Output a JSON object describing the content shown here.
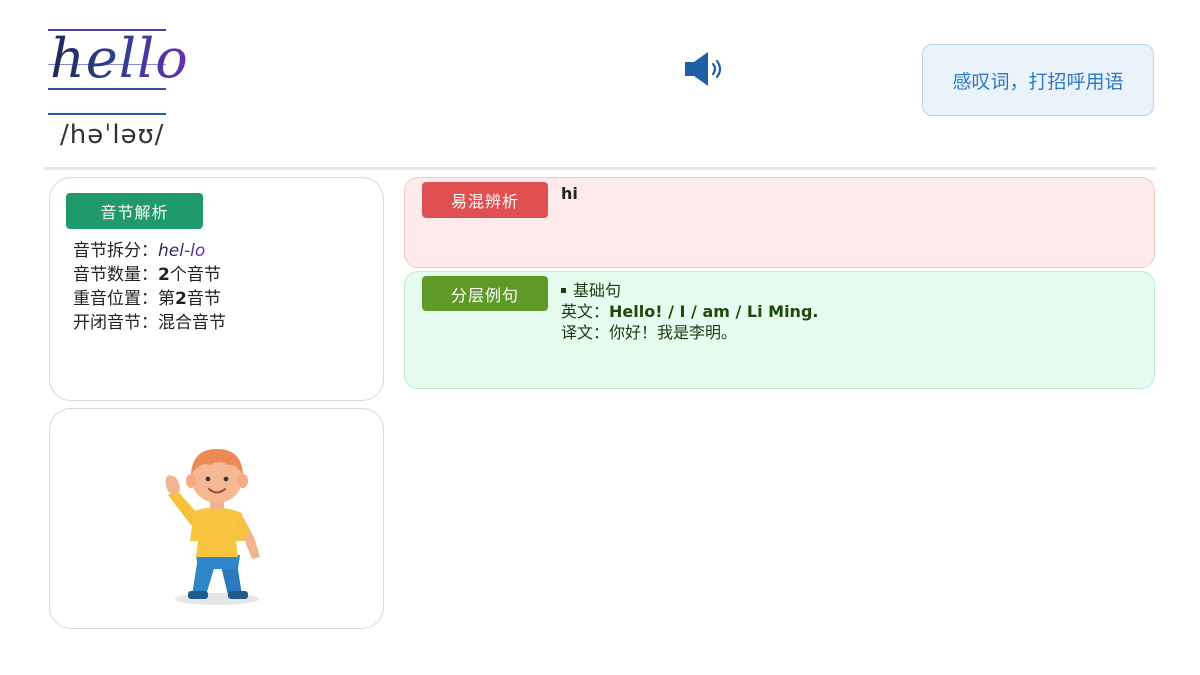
{
  "header": {
    "word": "hello",
    "phonetic": "/həˈləʊ/",
    "meaning": "感叹词，打招呼用语",
    "speaker_icon": "speaker-icon"
  },
  "syllable": {
    "tag": "音节解析",
    "split_label": "音节拆分：",
    "split_value": "hel-lo",
    "count_label": "音节数量：",
    "count_num": "2",
    "count_unit": "个音节",
    "stress_label": "重音位置：",
    "stress_pre": "第",
    "stress_num": "2",
    "stress_unit": "音节",
    "type_label": "开闭音节：",
    "type_value": "混合音节"
  },
  "confusion": {
    "tag": "易混辨析",
    "word": "hi"
  },
  "examples": {
    "tag": "分层例句",
    "level": "基础句",
    "en_label": "英文：",
    "en_text": "Hello! / I / am / Li Ming.",
    "cn_label": "译文：",
    "cn_text": "你好！我是李明。"
  },
  "illustration": {
    "icon": "waving-boy-illustration"
  },
  "colors": {
    "syllable_tag": "#1f9a6c",
    "confusion_tag": "#e05050",
    "example_tag": "#5e9a25",
    "confusion_bg": "#fdeaea",
    "example_bg": "#e6fcef",
    "meaning_text": "#2f78c4",
    "speaker": "#1f5fa8"
  }
}
